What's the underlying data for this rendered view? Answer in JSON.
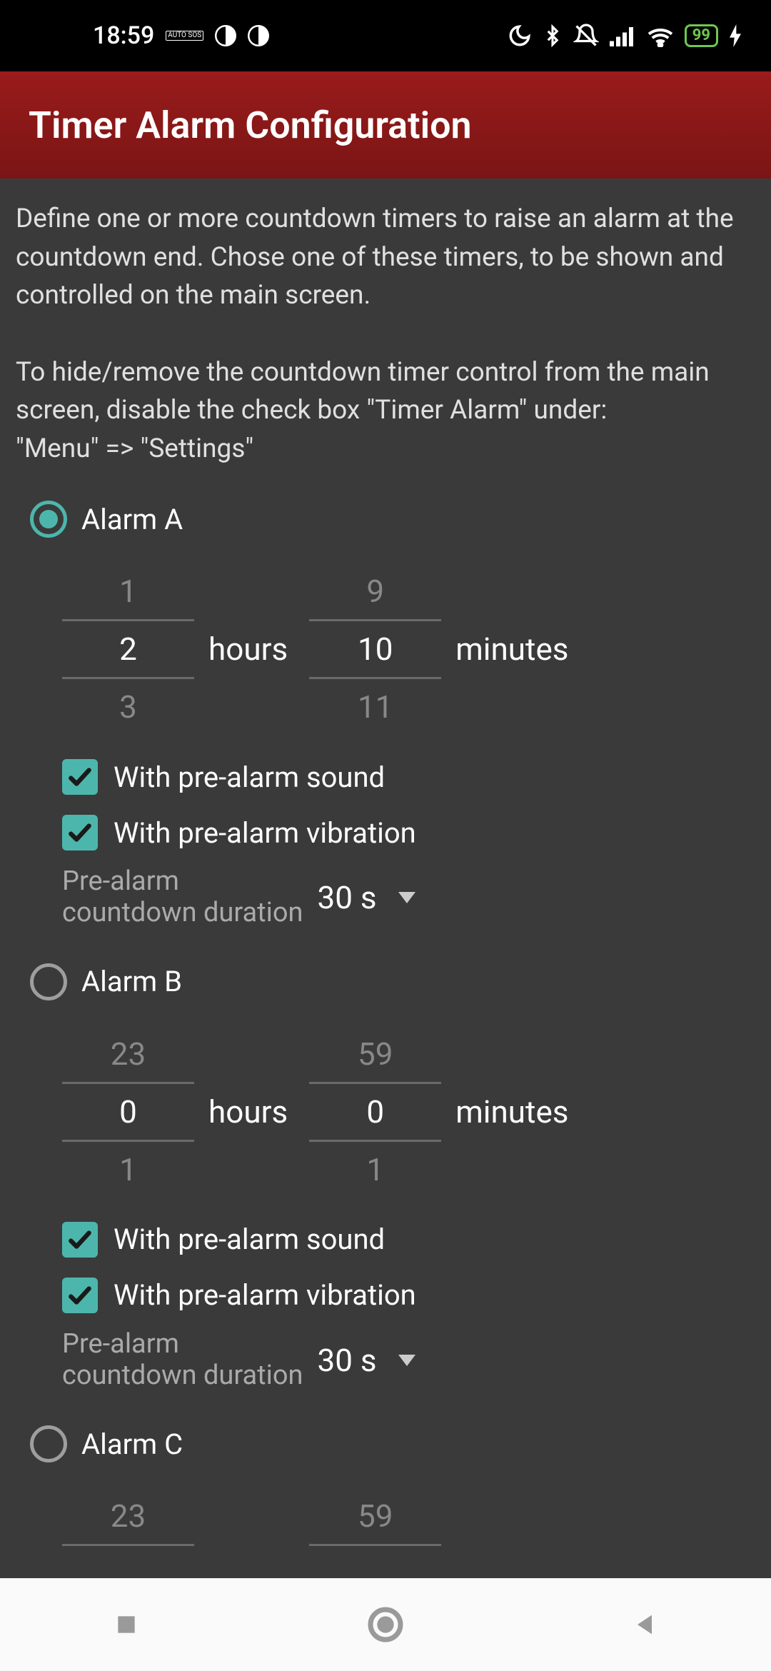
{
  "status": {
    "time": "18:59",
    "sos": "AUTO SOS",
    "battery": "99"
  },
  "header": {
    "title": "Timer Alarm Configuration"
  },
  "description": "Define one or more countdown timers to raise an alarm at the countdown end. Chose one of these timers, to be shown and controlled on the main screen.\n\n To hide/remove the countdown timer control from the main screen, disable the check box \"Timer Alarm\" under:\n \"Menu\" => \"Settings\"",
  "labels": {
    "hours": "hours",
    "minutes": "minutes",
    "pre_alarm_sound": "With pre-alarm sound",
    "pre_alarm_vibration": "With pre-alarm vibration",
    "pre_alarm_countdown": "Pre-alarm\ncountdown duration"
  },
  "alarms": [
    {
      "name": "Alarm A",
      "selected": true,
      "hours": {
        "prev": "1",
        "value": "2",
        "next": "3"
      },
      "minutes": {
        "prev": "9",
        "value": "10",
        "next": "11"
      },
      "pre_sound": true,
      "pre_vibration": true,
      "pre_duration": "30 s"
    },
    {
      "name": "Alarm B",
      "selected": false,
      "hours": {
        "prev": "23",
        "value": "0",
        "next": "1"
      },
      "minutes": {
        "prev": "59",
        "value": "0",
        "next": "1"
      },
      "pre_sound": true,
      "pre_vibration": true,
      "pre_duration": "30 s"
    },
    {
      "name": "Alarm C",
      "selected": false,
      "hours": {
        "prev": "23",
        "value": "",
        "next": ""
      },
      "minutes": {
        "prev": "59",
        "value": "",
        "next": ""
      }
    }
  ]
}
